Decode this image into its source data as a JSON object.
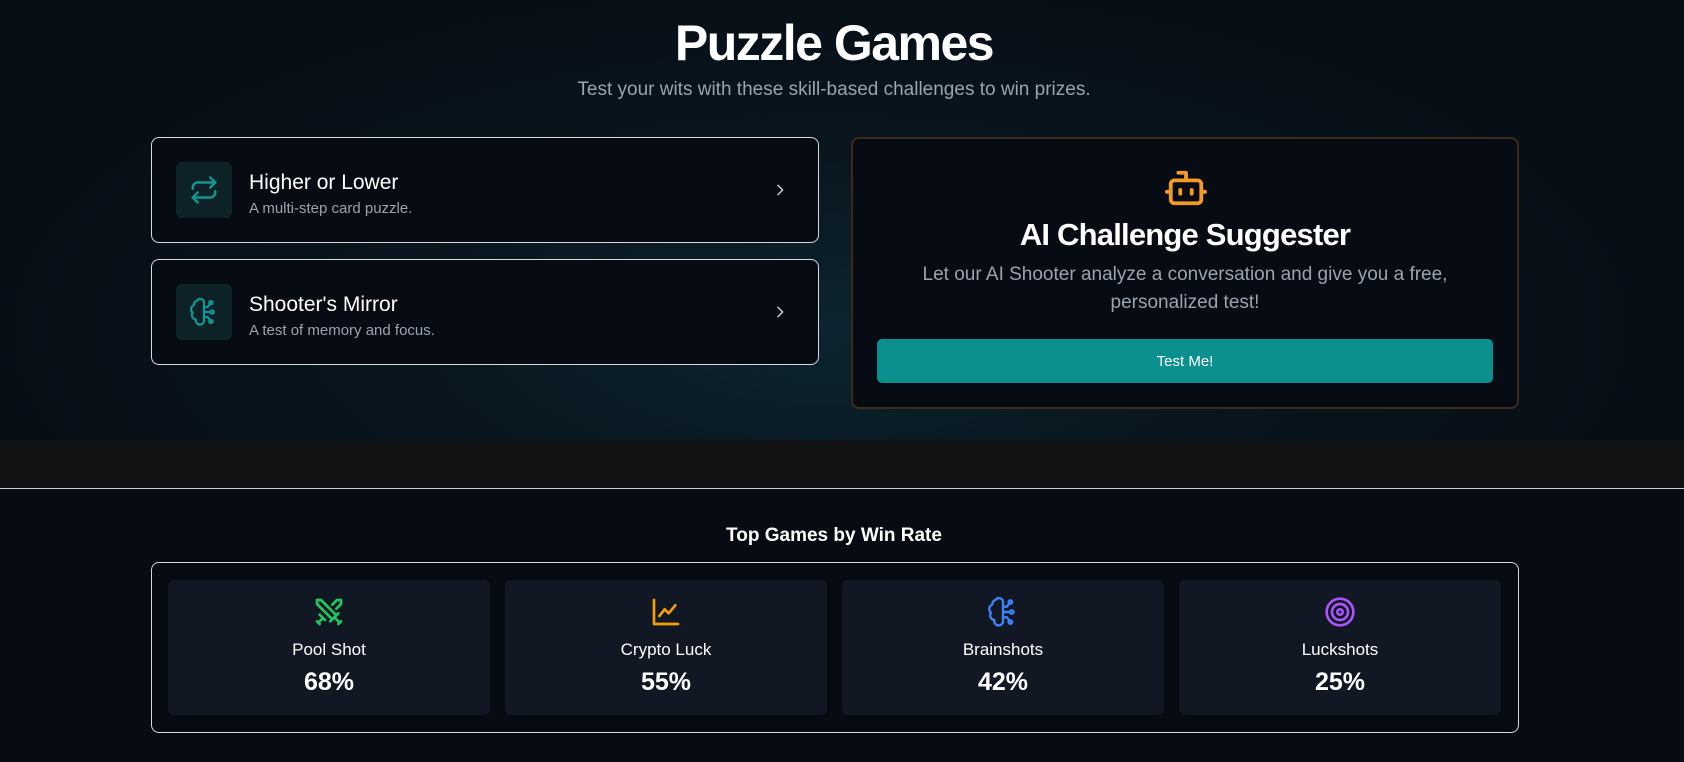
{
  "header": {
    "title": "Puzzle Games",
    "subtitle": "Test your wits with these skill-based challenges to win prizes."
  },
  "games": [
    {
      "name": "Higher or Lower",
      "description": "A multi-step card puzzle.",
      "icon": "repeat-arrows-icon"
    },
    {
      "name": "Shooter's Mirror",
      "description": "A test of memory and focus.",
      "icon": "brain-icon"
    }
  ],
  "ai_card": {
    "title": "AI Challenge Suggester",
    "description": "Let our AI Shooter analyze a conversation and give you a free, personalized test!",
    "button_label": "Test Me!",
    "icon": "robot-icon"
  },
  "top_games": {
    "title": "Top Games by Win Rate",
    "items": [
      {
        "name": "Pool Shot",
        "value": "68%",
        "icon": "crossed-swords-icon",
        "color": "#22c55e"
      },
      {
        "name": "Crypto Luck",
        "value": "55%",
        "icon": "line-chart-icon",
        "color": "#f59e0b"
      },
      {
        "name": "Brainshots",
        "value": "42%",
        "icon": "brain-icon",
        "color": "#3b82f6"
      },
      {
        "name": "Luckshots",
        "value": "25%",
        "icon": "target-icon",
        "color": "#a855f7"
      }
    ]
  },
  "colors": {
    "accent_teal": "#0b8f8f",
    "icon_teal": "#14958f",
    "robot_orange": "#f59a23",
    "muted_text": "#9aa3b0"
  }
}
